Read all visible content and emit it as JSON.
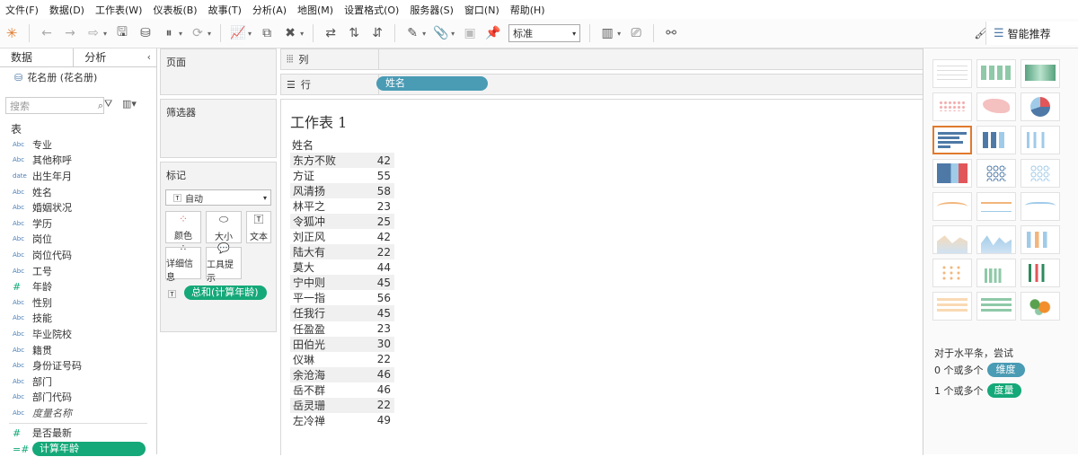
{
  "menu": [
    "文件(F)",
    "数据(D)",
    "工作表(W)",
    "仪表板(B)",
    "故事(T)",
    "分析(A)",
    "地图(M)",
    "设置格式(O)",
    "服务器(S)",
    "窗口(N)",
    "帮助(H)"
  ],
  "toolbar": {
    "fit_value": "标准",
    "showme_label": "智能推荐"
  },
  "datapane": {
    "tab_data": "数据",
    "tab_analysis": "分析",
    "datasource": "花名册 (花名册)",
    "search_placeholder": "搜索",
    "section": "表",
    "fields": [
      {
        "type": "Abc",
        "label": "专业"
      },
      {
        "type": "Abc",
        "label": "其他称呼"
      },
      {
        "type": "date",
        "label": "出生年月"
      },
      {
        "type": "Abc",
        "label": "姓名"
      },
      {
        "type": "Abc",
        "label": "婚姻状况"
      },
      {
        "type": "Abc",
        "label": "学历"
      },
      {
        "type": "Abc",
        "label": "岗位"
      },
      {
        "type": "Abc",
        "label": "岗位代码"
      },
      {
        "type": "Abc",
        "label": "工号"
      },
      {
        "type": "#",
        "label": "年龄"
      },
      {
        "type": "Abc",
        "label": "性别"
      },
      {
        "type": "Abc",
        "label": "技能"
      },
      {
        "type": "Abc",
        "label": "毕业院校"
      },
      {
        "type": "Abc",
        "label": "籍贯"
      },
      {
        "type": "Abc",
        "label": "身份证号码"
      },
      {
        "type": "Abc",
        "label": "部门"
      },
      {
        "type": "Abc",
        "label": "部门代码"
      },
      {
        "type": "Abc",
        "label": "度量名称"
      }
    ],
    "calc_fields": [
      {
        "type": "#",
        "label": "是否最新"
      },
      {
        "type": "=#",
        "label": "计算年龄"
      }
    ]
  },
  "cards": {
    "pages": "页面",
    "filters": "筛选器",
    "marks": "标记",
    "marks_type": "自动",
    "color": "颜色",
    "size": "大小",
    "text": "文本",
    "detail": "详细信息",
    "tooltip": "工具提示",
    "text_pill": "总和(计算年龄)"
  },
  "shelves": {
    "columns": "列",
    "rows": "行",
    "rows_pill": "姓名"
  },
  "view": {
    "title": "工作表 1",
    "row_header": "姓名",
    "rows": [
      {
        "name": "东方不败",
        "value": 42
      },
      {
        "name": "方证",
        "value": 55
      },
      {
        "name": "风清扬",
        "value": 58
      },
      {
        "name": "林平之",
        "value": 23
      },
      {
        "name": "令狐冲",
        "value": 25
      },
      {
        "name": "刘正风",
        "value": 42
      },
      {
        "name": "陆大有",
        "value": 22
      },
      {
        "name": "莫大",
        "value": 44
      },
      {
        "name": "宁中则",
        "value": 45
      },
      {
        "name": "平一指",
        "value": 56
      },
      {
        "name": "任我行",
        "value": 45
      },
      {
        "name": "任盈盈",
        "value": 23
      },
      {
        "name": "田伯光",
        "value": 30
      },
      {
        "name": "仪琳",
        "value": 22
      },
      {
        "name": "余沧海",
        "value": 46
      },
      {
        "name": "岳不群",
        "value": 46
      },
      {
        "name": "岳灵珊",
        "value": 22
      },
      {
        "name": "左冷禅",
        "value": 49
      }
    ]
  },
  "showme": {
    "hint": "对于水平条，尝试",
    "dim_text": "0 个或多个",
    "dim_pill": "维度",
    "mea_text": "1 个或多个",
    "mea_pill": "度量",
    "colors": {
      "selected": "#e07a2d",
      "blue": "#4e79a7",
      "teal": "#4a9bb4",
      "green": "#15a878"
    }
  }
}
